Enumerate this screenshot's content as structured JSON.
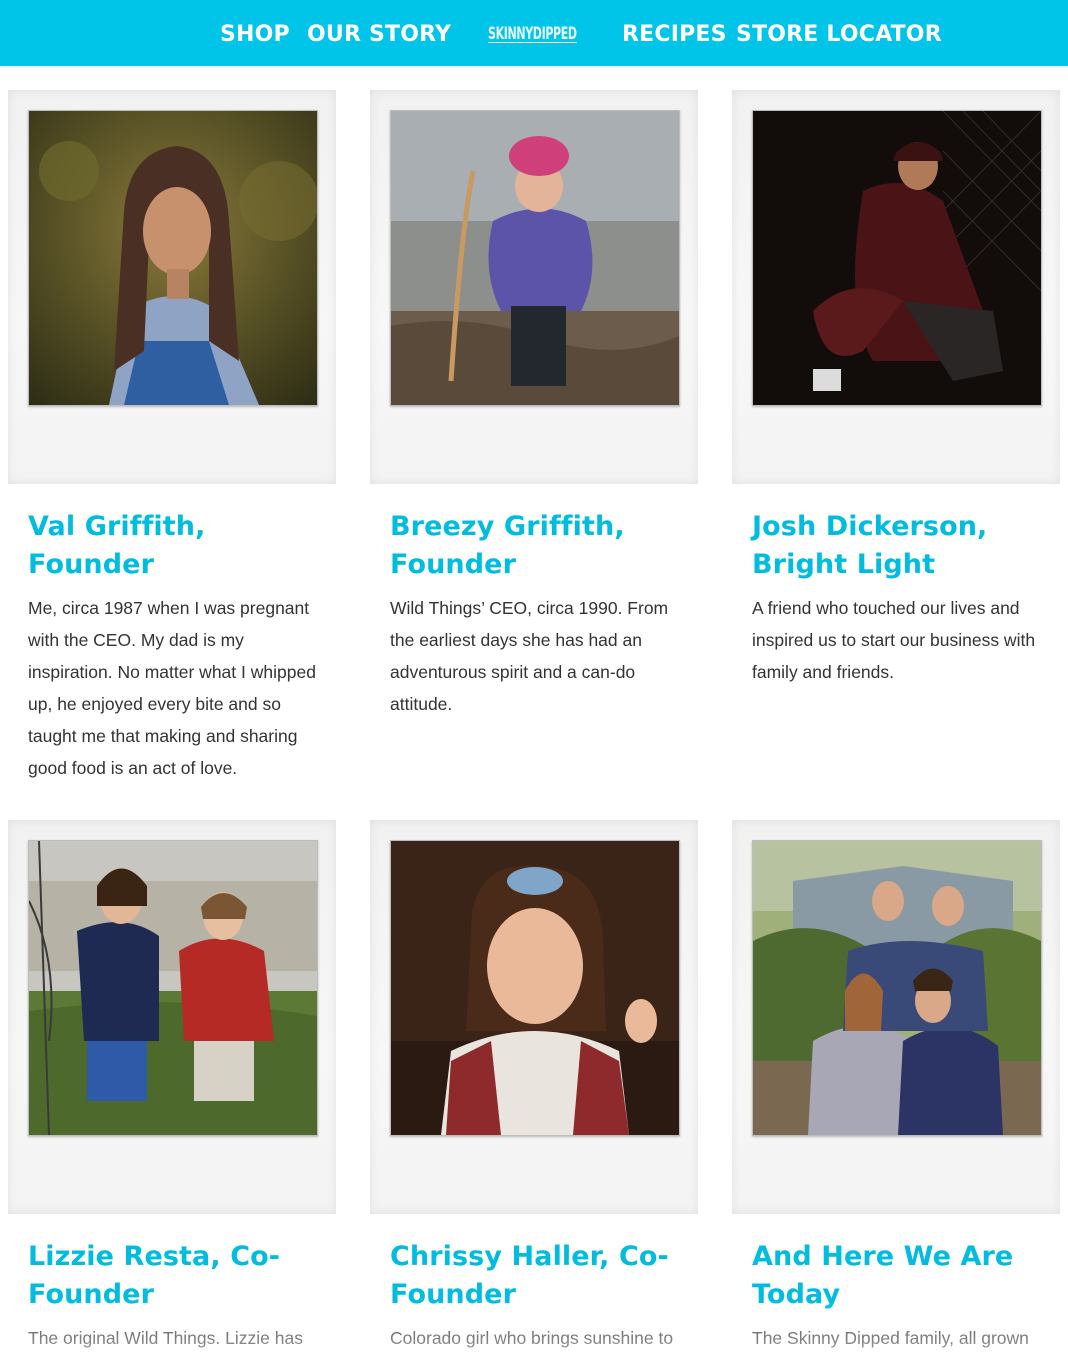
{
  "nav": {
    "shop": "SHOP",
    "our_story": "OUR STORY",
    "logo": "SKINNYDIPPED",
    "recipes": "RECIPES",
    "store_locator": "STORE LOCATOR"
  },
  "colors": {
    "nav_bar": "#00c4e8",
    "heading": "#00bcdf",
    "body_text": "#333333"
  },
  "people": [
    {
      "title": "Val Griffith, Founder",
      "text": "Me, circa 1987 when I was pregnant with the CEO. My dad is my inspiration. No matter what I whipped up, he enjoyed every bite and so taught me that making and sharing good food is an act of love."
    },
    {
      "title": "Breezy Griffith, Founder",
      "text": "Wild Things’ CEO, circa 1990. From the earliest days she has had an adventurous spirit and a can-do attitude."
    },
    {
      "title": "Josh Dickerson, Bright Light",
      "text": "A friend who touched our lives and inspired us to start our business with family and friends."
    },
    {
      "title": "Lizzie Resta, Co-Founder",
      "text": "The original Wild Things. Lizzie has"
    },
    {
      "title": "Chrissy Haller, Co-Founder",
      "text": "Colorado girl who brings sunshine to"
    },
    {
      "title": "And Here We Are Today",
      "text": "The Skinny Dipped family, all grown"
    }
  ]
}
